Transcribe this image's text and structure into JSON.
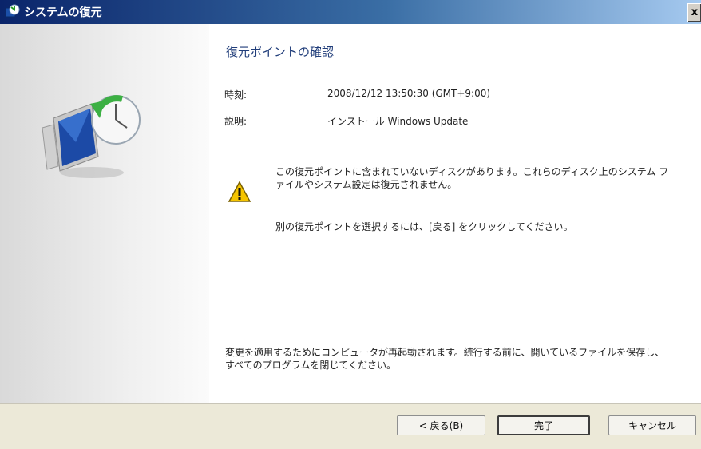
{
  "window": {
    "title": "システムの復元",
    "close_glyph": "x"
  },
  "confirm": {
    "heading": "復元ポイントの確認",
    "time_label": "時刻:",
    "time_value": "2008/12/12 13:50:30 (GMT+9:00)",
    "description_label": "説明:",
    "description_value": "インストール Windows Update",
    "warning_text": "この復元ポイントに含まれていないディスクがあります。これらのディスク上のシステム ファイルやシステム設定は復元されません。",
    "hint_text": "別の復元ポイントを選択するには、[戻る] をクリックしてください。",
    "save_text": "変更を適用するためにコンピュータが再起動されます。続行する前に、開いているファイルを保存し、すべてのプログラムを閉じてください。"
  },
  "buttons": {
    "back_label": "< 戻る(B)",
    "finish_label": "完了",
    "cancel_label": "キャンセル"
  },
  "icons": {
    "title": "system-restore-icon",
    "hero": "system-restore-icon",
    "warning": "warning-icon"
  },
  "colors": {
    "titlebar_dark": "#0a246a",
    "titlebar_light": "#a6caf0",
    "heading": "#203d7a",
    "footer": "#ece9d8"
  }
}
